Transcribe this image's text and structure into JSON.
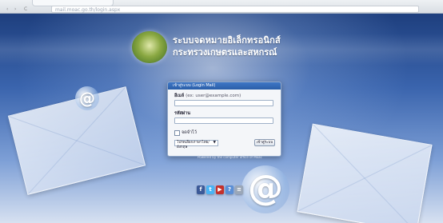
{
  "browser": {
    "address": "mail.moac.go.th/login.aspx",
    "nav_back": "‹",
    "nav_forward": "›",
    "nav_reload": "C"
  },
  "header": {
    "title": "ระบบจดหมายอิเล็กทรอนิกส์",
    "subtitle": "กระทรวงเกษตรและสหกรณ์"
  },
  "decor": {
    "at_small": "@",
    "at_large": "@"
  },
  "login": {
    "header_text": "เข้าสู่ระบบ (Login Mail)",
    "email_label": "อีเมล์",
    "email_hint": "(ex: user@example.com)",
    "email_value": "",
    "password_label": "รหัสผ่าน",
    "password_value": "",
    "remember_label": "จดจำไว้",
    "language_selected": "โปรดเลือกภาษาไทย/อังกฤษ",
    "language_caret": "▼",
    "submit_label": "เข้าสู่ระบบ"
  },
  "footer": {
    "note": "Powered by the computer office of Moac"
  },
  "social": [
    {
      "name": "facebook-icon",
      "glyph": "f",
      "color": "#3b5998"
    },
    {
      "name": "twitter-icon",
      "glyph": "t",
      "color": "#4ab3f4"
    },
    {
      "name": "youtube-icon",
      "glyph": "▶",
      "color": "#c4302b"
    },
    {
      "name": "help-icon",
      "glyph": "?",
      "color": "#5b8fd6"
    },
    {
      "name": "document-icon",
      "glyph": "≡",
      "color": "#9aa7b8"
    }
  ]
}
